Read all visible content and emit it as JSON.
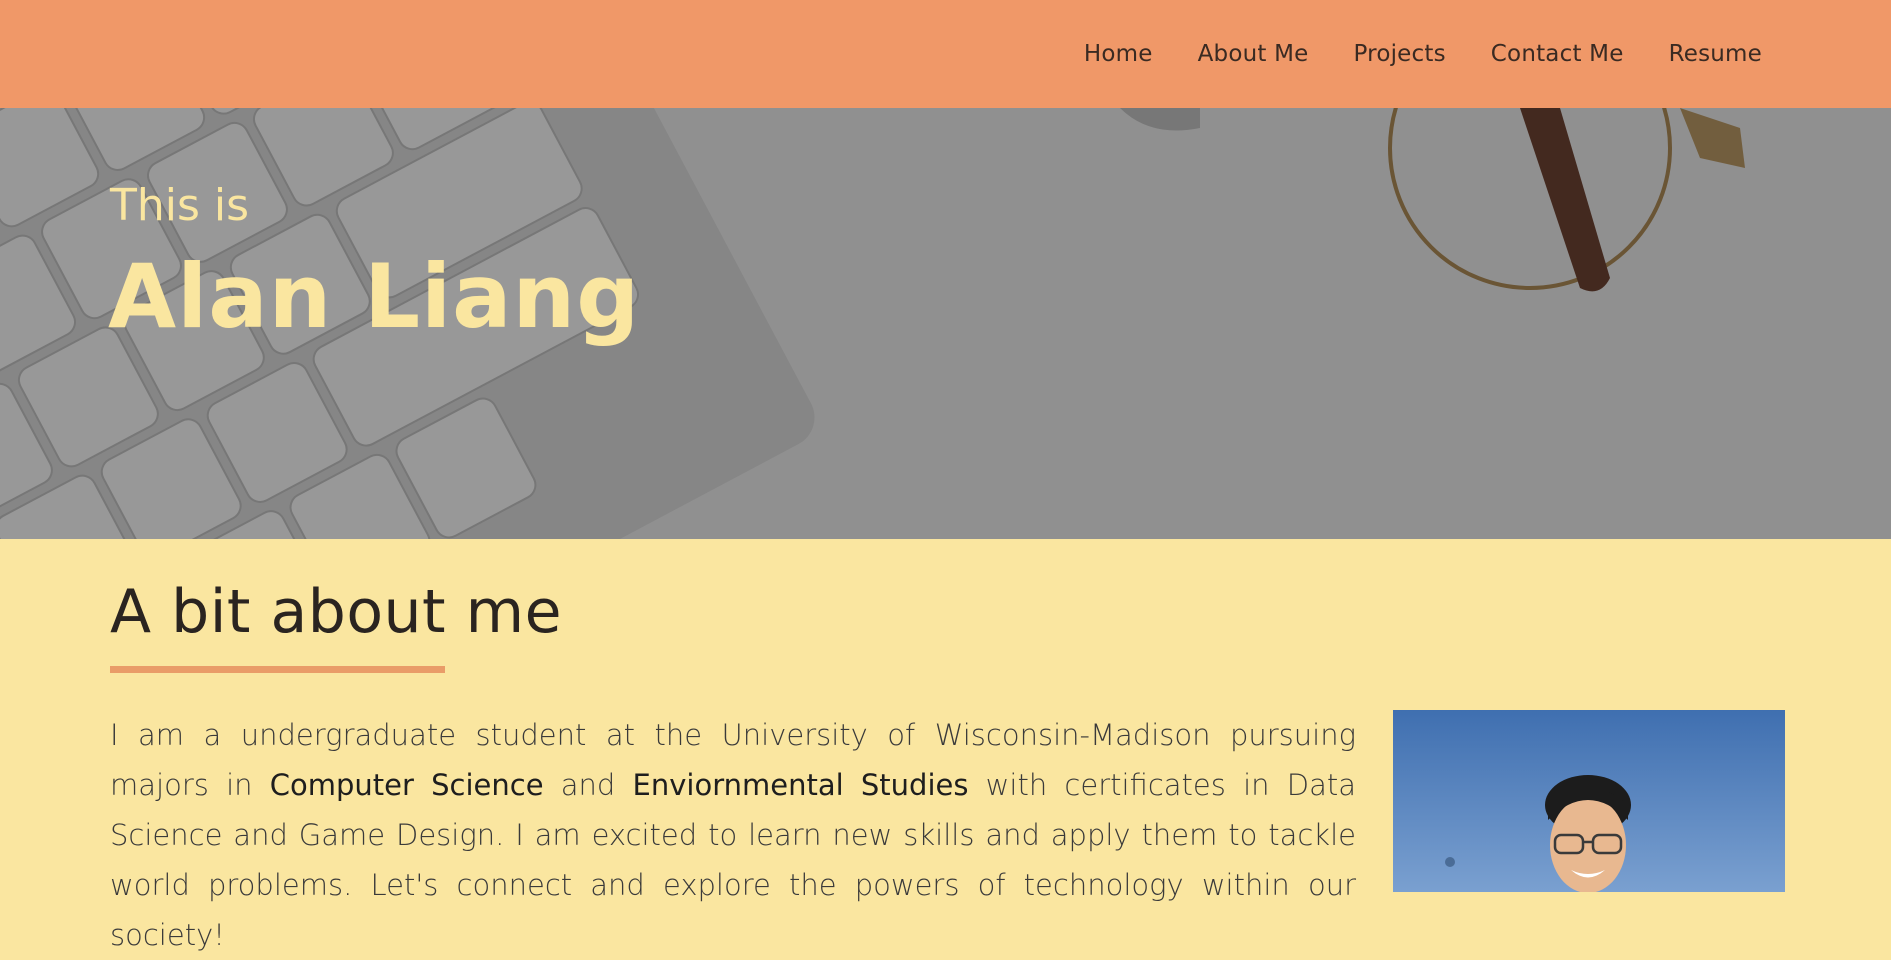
{
  "nav": {
    "items": [
      {
        "label": "Home"
      },
      {
        "label": "About Me"
      },
      {
        "label": "Projects"
      },
      {
        "label": "Contact Me"
      },
      {
        "label": "Resume"
      }
    ]
  },
  "hero": {
    "pretitle": "This is",
    "title": "Alan Liang"
  },
  "about": {
    "heading": "A bit about me",
    "text_part1": "I am a undergraduate student at the University of Wisconsin-Madison pursuing majors in ",
    "major1": "Computer Science",
    "text_and": " and ",
    "major2": "Enviornmental Studies",
    "text_part2": " with certificates in Data Science and Game Design. I am excited to learn new skills and apply them to tackle world problems. Let's connect and explore the powers of technology within our society!"
  },
  "colors": {
    "navbar": "#f09868",
    "accent_yellow": "#fae6a0",
    "underline": "#e99c68"
  }
}
